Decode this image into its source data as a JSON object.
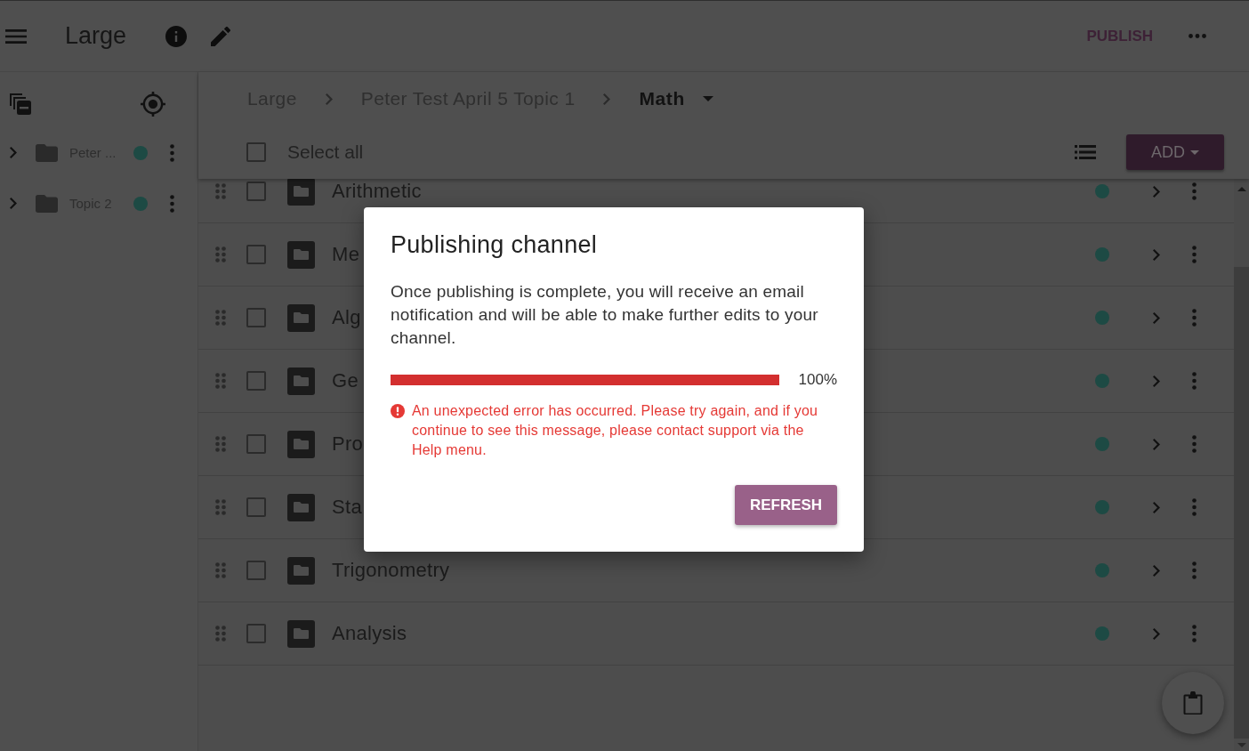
{
  "app_bar": {
    "title": "Large",
    "publish_button": "PUBLISH"
  },
  "sidebar": {
    "items": [
      {
        "label": "Peter ...",
        "expanded": false
      },
      {
        "label": "Topic 2",
        "expanded": false
      }
    ]
  },
  "breadcrumbs": [
    {
      "label": "Large",
      "current": false
    },
    {
      "label": "Peter Test April 5 Topic 1",
      "current": false
    },
    {
      "label": "Math",
      "current": true
    }
  ],
  "toolbar": {
    "select_all": {
      "label": "Select all",
      "checked": false
    },
    "add_button": "ADD"
  },
  "rows": [
    {
      "title": "Arithmetic",
      "checked": false
    },
    {
      "title": "Me",
      "checked": false
    },
    {
      "title": "Alg",
      "checked": false
    },
    {
      "title": "Ge",
      "checked": false
    },
    {
      "title": "Pro",
      "checked": false
    },
    {
      "title": "Sta",
      "checked": false
    },
    {
      "title": "Trigonometry",
      "checked": false
    },
    {
      "title": "Analysis",
      "checked": false
    }
  ],
  "dialog": {
    "title": "Publishing channel",
    "message": "Once publishing is complete, you will receive an email notification and will be able to make further edits to your channel.",
    "progress": {
      "level": 1,
      "reading": "100%"
    },
    "error": "An unexpected error has occurred. Please try again, and if you continue to see this message, please contact support via the Help menu.",
    "button": "REFRESH"
  }
}
